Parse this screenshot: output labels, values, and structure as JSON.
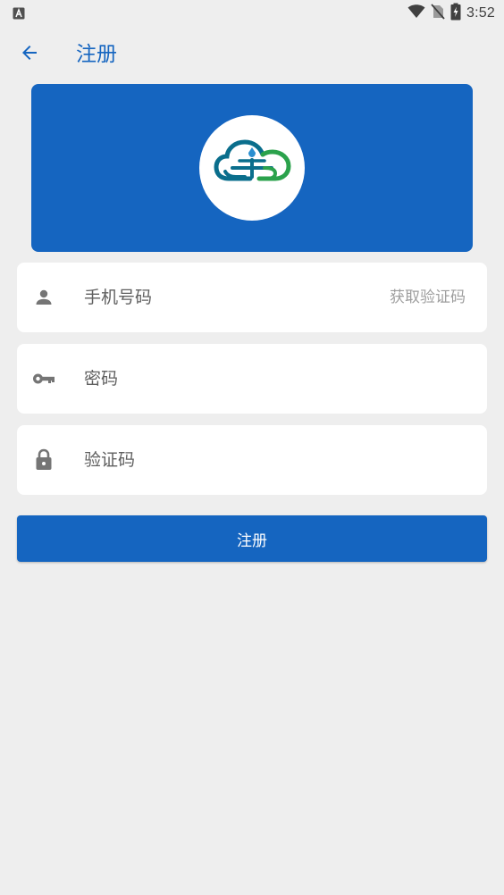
{
  "status_bar": {
    "time": "3:52",
    "notification_icon": "a-letter-icon",
    "wifi_icon": "wifi-icon",
    "signal_icon": "no-sim-icon",
    "battery_icon": "battery-charging-icon"
  },
  "app_bar": {
    "back_icon": "arrow-left-icon",
    "title": "注册"
  },
  "banner": {
    "logo_icon": "cloud-logo-icon"
  },
  "form": {
    "phone": {
      "icon": "person-icon",
      "placeholder": "手机号码",
      "value": "",
      "get_code_label": "获取验证码"
    },
    "password": {
      "icon": "key-icon",
      "placeholder": "密码",
      "value": ""
    },
    "code": {
      "icon": "lock-icon",
      "placeholder": "验证码",
      "value": ""
    },
    "submit_label": "注册"
  },
  "colors": {
    "primary": "#1565c0",
    "background": "#eeeeee",
    "card": "#ffffff",
    "icon_gray": "#757575",
    "hint_gray": "#9e9e9e",
    "logo_teal": "#0a6e8c",
    "logo_green": "#2ba24c"
  }
}
